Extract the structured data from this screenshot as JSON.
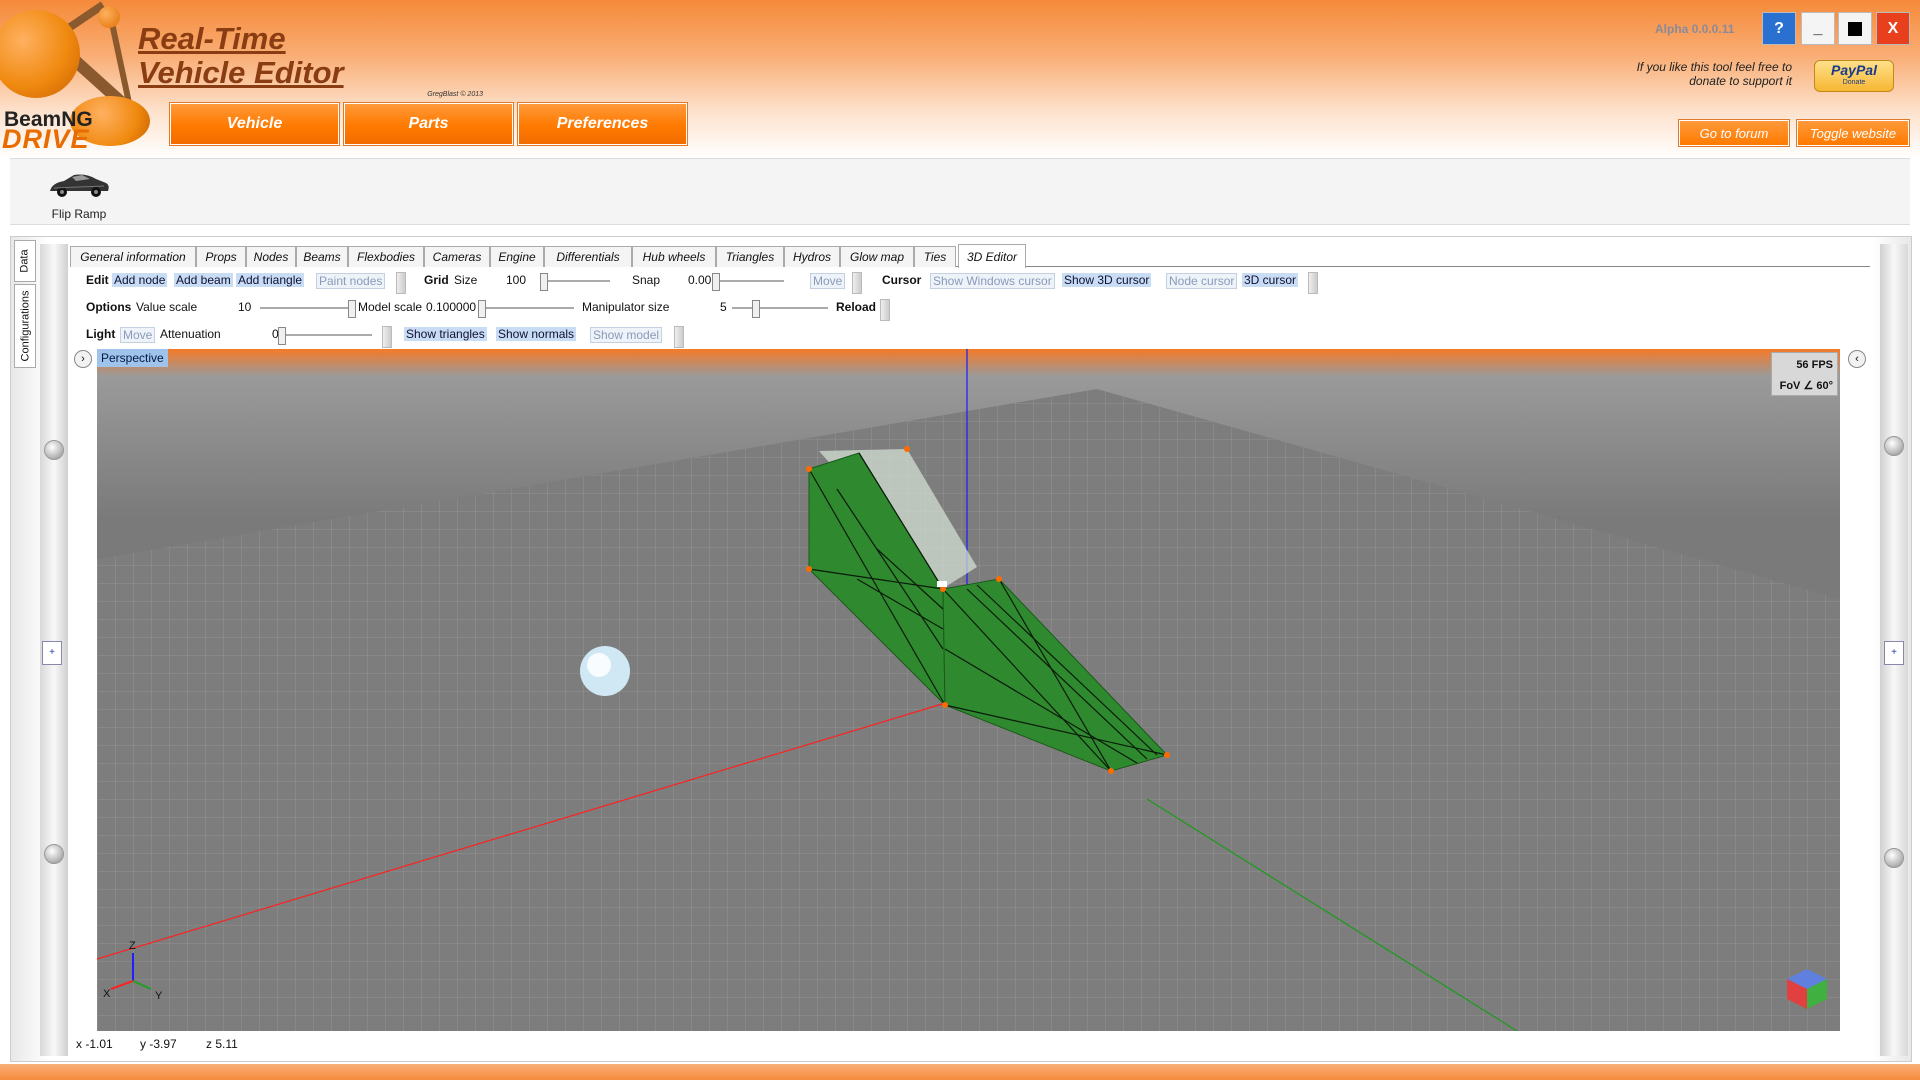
{
  "brand": {
    "name": "BeamNG",
    "product": "DRIVE"
  },
  "app": {
    "title_line1": "Real-Time",
    "title_line2": "Vehicle Editor",
    "credit": "GregBlast © 2013",
    "version": "Alpha 0.0.0.11"
  },
  "nav": {
    "vehicle": "Vehicle",
    "parts": "Parts",
    "preferences": "Preferences"
  },
  "window": {
    "help": "?",
    "minimize": "_",
    "close": "X"
  },
  "donate": {
    "text_line1": "If you like this tool feel free to",
    "text_line2": "donate to support it",
    "paypal": "PayPal",
    "paypal_sub": "Donate"
  },
  "links": {
    "forum": "Go to forum",
    "website": "Toggle website"
  },
  "vehicles": [
    {
      "label": "Flip Ramp",
      "icon": "car-icon"
    }
  ],
  "side_tabs": [
    "Data",
    "Configurations"
  ],
  "tabs": [
    "General information",
    "Props",
    "Nodes",
    "Beams",
    "Flexbodies",
    "Cameras",
    "Engine",
    "Differentials",
    "Hub wheels",
    "Triangles",
    "Hydros",
    "Glow map",
    "Ties",
    "3D Editor"
  ],
  "active_tab": "3D Editor",
  "toolbar": {
    "edit": {
      "label": "Edit",
      "add_node": "Add node",
      "add_beam": "Add beam",
      "add_triangle": "Add triangle",
      "paint_nodes": "Paint nodes"
    },
    "grid": {
      "label": "Grid",
      "size_label": "Size",
      "size_value": "100",
      "snap_label": "Snap",
      "snap_value": "0.00",
      "move": "Move"
    },
    "cursor": {
      "label": "Cursor",
      "show_windows": "Show Windows cursor",
      "show_3d": "Show 3D cursor",
      "node_cursor": "Node cursor",
      "cursor_3d": "3D cursor"
    },
    "options": {
      "label": "Options",
      "value_scale_label": "Value scale",
      "value_scale": "10",
      "model_scale_label": "Model scale",
      "model_scale": "0.100000",
      "manip_label": "Manipulator size",
      "manip_value": "5",
      "reload": "Reload"
    },
    "light": {
      "label": "Light",
      "move": "Move",
      "attenuation_label": "Attenuation",
      "attenuation_value": "0",
      "show_triangles": "Show triangles",
      "show_normals": "Show normals",
      "show_model": "Show model"
    }
  },
  "viewport": {
    "mode": "Perspective",
    "fps": "56 FPS",
    "fov": "FoV ∠ 60°",
    "axis_x": "X",
    "axis_y": "Y",
    "axis_z": "Z",
    "nav_left": "›",
    "nav_right": "‹"
  },
  "status": {
    "x": "x -1.01",
    "y": "y -3.97",
    "z": "z 5.11"
  },
  "colors": {
    "accent": "#ff7a00",
    "ramp": "#2f8a2f",
    "grid_bg": "#6a6a6a"
  }
}
